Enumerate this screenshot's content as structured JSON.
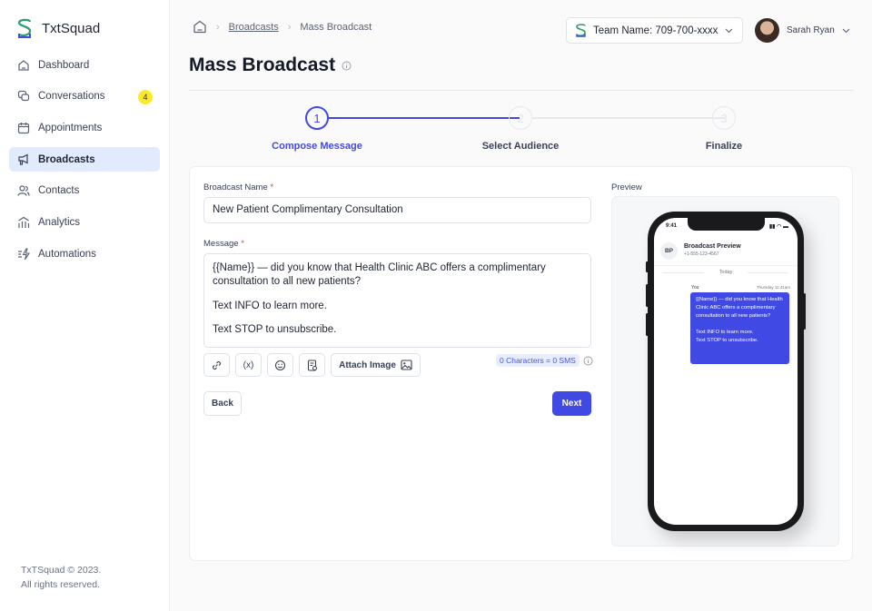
{
  "app": {
    "name": "TxtSquad"
  },
  "sidebar": {
    "items": [
      {
        "label": "Dashboard",
        "icon": "home-icon"
      },
      {
        "label": "Conversations",
        "icon": "chat-icon",
        "badge": "4"
      },
      {
        "label": "Appointments",
        "icon": "calendar-icon"
      },
      {
        "label": "Broadcasts",
        "icon": "megaphone-icon",
        "active": true
      },
      {
        "label": "Contacts",
        "icon": "users-icon"
      },
      {
        "label": "Analytics",
        "icon": "analytics-icon"
      },
      {
        "label": "Automations",
        "icon": "automation-icon"
      }
    ],
    "footer_line1": "TxTSquad © 2023.",
    "footer_line2": "All rights reserved."
  },
  "breadcrumb": {
    "link": "Broadcasts",
    "current": "Mass Broadcast"
  },
  "page": {
    "title": "Mass Broadcast"
  },
  "header": {
    "team_label": "Team Name: 709-700-xxxx",
    "user_name": "Sarah Ryan"
  },
  "stepper": {
    "steps": [
      {
        "number": "1",
        "label": "Compose Message",
        "state": "active"
      },
      {
        "number": "2",
        "label": "Select Audience",
        "state": "pending"
      },
      {
        "number": "3",
        "label": "Finalize",
        "state": "pending"
      }
    ],
    "accent": "#4149e4"
  },
  "form": {
    "name_label": "Broadcast Name",
    "name_value": "New Patient Complimentary Consultation",
    "message_label": "Message",
    "required_mark": "*",
    "message_lines": [
      "{{Name}} — did you know that Health Clinic ABC offers a complimentary consultation to all new patients?",
      "Text INFO to learn more.",
      "Text STOP to unsubscribe."
    ],
    "toolbar": {
      "variable_label": "(x)",
      "attach_label": "Attach Image"
    },
    "counter": "0 Characters = 0 SMS",
    "back_label": "Back",
    "next_label": "Next"
  },
  "preview": {
    "label": "Preview",
    "time": "9:41",
    "avatar_initials": "BP",
    "contact_name": "Broadcast Preview",
    "contact_number": "+1-555-123-4567",
    "day_divider": "Today",
    "sender": "You",
    "timestamp": "Thursday 11:41am",
    "bubble_lines": [
      "{{Name}} — did you know that Health Clinic ABC offers a complimentary consultation to all new patients?",
      "Text INFO to learn more.",
      "Text STOP to unsubscribe."
    ]
  }
}
